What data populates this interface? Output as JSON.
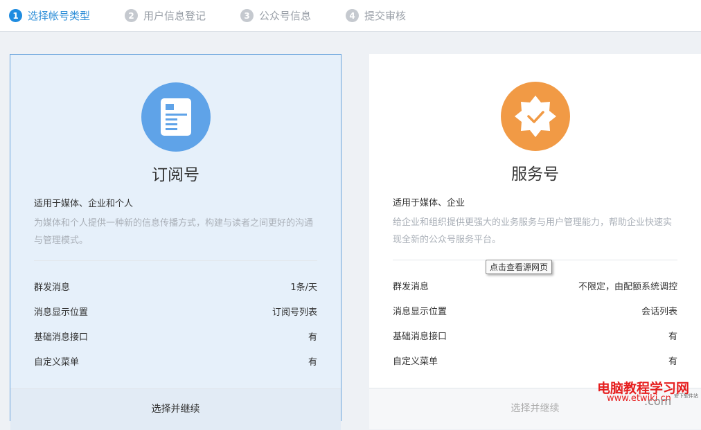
{
  "steps": [
    {
      "num": "1",
      "label": "选择帐号类型"
    },
    {
      "num": "2",
      "label": "用户信息登记"
    },
    {
      "num": "3",
      "label": "公众号信息"
    },
    {
      "num": "4",
      "label": "提交审核"
    }
  ],
  "cards": [
    {
      "title": "订阅号",
      "subtitle": "适用于媒体、企业和个人",
      "desc": "为媒体和个人提供一种新的信息传播方式，构建与读者之间更好的沟通与管理模式。",
      "icon": "document-icon",
      "color": "#5fa3e8",
      "rows": [
        {
          "k": "群发消息",
          "v": "1条/天"
        },
        {
          "k": "消息显示位置",
          "v": "订阅号列表"
        },
        {
          "k": "基础消息接口",
          "v": "有"
        },
        {
          "k": "自定义菜单",
          "v": "有"
        }
      ],
      "button": "选择并继续"
    },
    {
      "title": "服务号",
      "subtitle": "适用于媒体、企业",
      "desc": "给企业和组织提供更强大的业务服务与用户管理能力，帮助企业快速实现全新的公众号服务平台。",
      "icon": "verified-badge-icon",
      "color": "#f19a45",
      "rows": [
        {
          "k": "群发消息",
          "v": "不限定，由配额系统调控"
        },
        {
          "k": "消息显示位置",
          "v": "会话列表"
        },
        {
          "k": "基础消息接口",
          "v": "有"
        },
        {
          "k": "自定义菜单",
          "v": "有"
        }
      ],
      "button": "选择并继续"
    }
  ],
  "tooltip": "点击查看源网页",
  "watermark": {
    "line1": "电脑教程学习网",
    "line2": "www.etwiki.cn",
    "line3": ".com",
    "line4": "安下软件站"
  }
}
